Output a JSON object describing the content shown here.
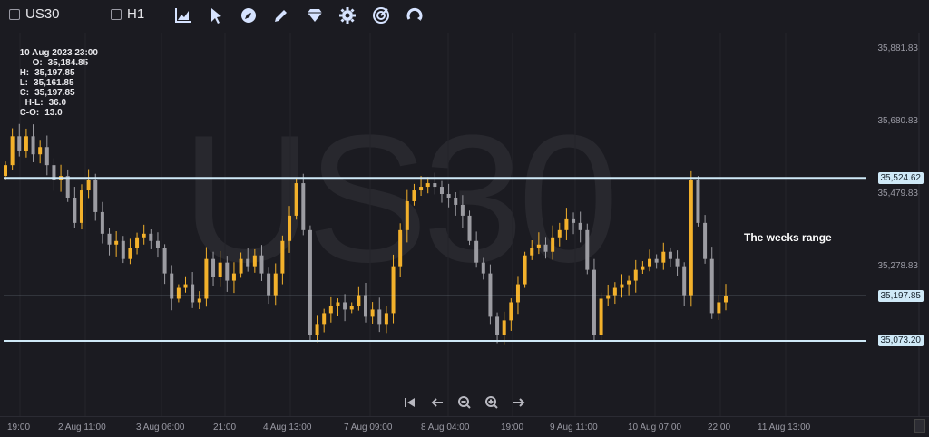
{
  "toolbar": {
    "symbol": "US30",
    "timeframe": "H1",
    "tools": [
      "chart-type-icon",
      "cursor-icon",
      "compass-icon",
      "pencil-icon",
      "diamond-icon",
      "gear-icon",
      "target-icon",
      "refresh-icon"
    ]
  },
  "ohlc": {
    "datetime": "10 Aug 2023 23:00",
    "open_label": "O:",
    "open": "35,184.85",
    "high_label": "H:",
    "high": "35,197.85",
    "low_label": "L:",
    "low": "35,161.85",
    "close_label": "C:",
    "close": "35,197.85",
    "hl_label": "H-L:",
    "hl": "36.0",
    "co_label": "C-O:",
    "co": "13.0"
  },
  "watermark": "US30",
  "annotation": "The weeks range",
  "price_axis": {
    "ticks": [
      "35,881.83",
      "35,680.83",
      "35,479.83",
      "35,278.83"
    ],
    "tags": [
      "35,524.62",
      "35,197.85",
      "35,073.20"
    ]
  },
  "time_axis": [
    "19:00",
    "2 Aug 11:00",
    "3 Aug 06:00",
    "21:00",
    "4 Aug 13:00",
    "7 Aug 09:00",
    "8 Aug 04:00",
    "19:00",
    "9 Aug 11:00",
    "10 Aug 07:00",
    "22:00",
    "11 Aug 13:00"
  ],
  "colors": {
    "bull": "#f3b12b",
    "bear": "#9c9ca2",
    "line": "#cfe9f7",
    "bg": "#1b1b21"
  },
  "chart_data": {
    "type": "candlestick",
    "horizontal_levels": [
      35524.62,
      35197.85,
      35073.2
    ],
    "ylim": [
      35000,
      35900
    ]
  }
}
